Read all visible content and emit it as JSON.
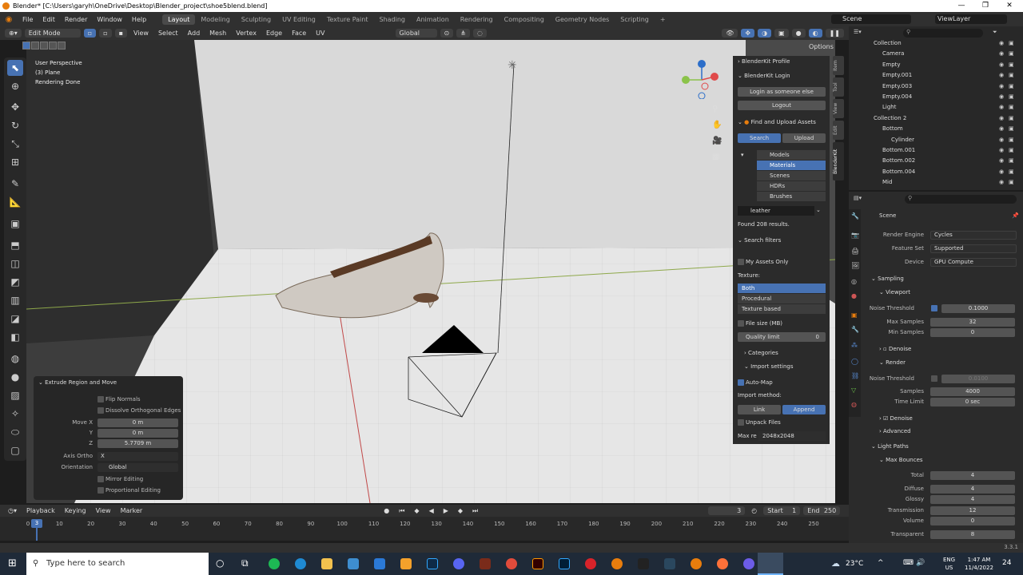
{
  "window": {
    "title": "Blender* [C:\\Users\\garyh\\OneDrive\\Desktop\\Blender_project\\shoe5blend.blend]"
  },
  "menu": [
    "File",
    "Edit",
    "Render",
    "Window",
    "Help"
  ],
  "workspaces": [
    "Layout",
    "Modeling",
    "Sculpting",
    "UV Editing",
    "Texture Paint",
    "Shading",
    "Animation",
    "Rendering",
    "Compositing",
    "Geometry Nodes",
    "Scripting"
  ],
  "scene": {
    "label": "Scene",
    "viewlayer": "ViewLayer"
  },
  "header": {
    "mode": "Edit Mode",
    "items": [
      "View",
      "Select",
      "Add",
      "Mesh",
      "Vertex",
      "Edge",
      "Face",
      "UV"
    ],
    "orientation": "Global",
    "options": "Options"
  },
  "viewport_info": {
    "line1": "User Perspective",
    "line2": "(3) Plane",
    "line3": "Rendering Done"
  },
  "redo_panel": {
    "title": "Extrude Region and Move",
    "flip_normals": "Flip Normals",
    "dissolve": "Dissolve Orthogonal Edges",
    "move_x_label": "Move X",
    "move_x": "0 m",
    "y_label": "Y",
    "y": "0 m",
    "z_label": "Z",
    "z": "5.7709 m",
    "axis_ortho_label": "Axis Ortho",
    "axis_ortho": "X",
    "orientation_label": "Orientation",
    "orientation": "Global",
    "mirror": "Mirror Editing",
    "proportional": "Proportional Editing"
  },
  "npanel": {
    "profile": "BlenderKit Profile",
    "login": "BlenderKit Login",
    "login_other": "Login as someone else",
    "logout": "Logout",
    "find": "Find and Upload Assets",
    "search": "Search",
    "upload": "Upload",
    "categories": [
      "Models",
      "Materials",
      "Scenes",
      "HDRs",
      "Brushes"
    ],
    "query": "leather",
    "found": "Found 208 results.",
    "search_filters": "Search filters",
    "my_assets": "My Assets Only",
    "texture_label": "Texture:",
    "texture_opts": [
      "Both",
      "Procedural",
      "Texture based"
    ],
    "file_size": "File size (MB)",
    "quality_label": "Quality limit",
    "quality_val": "0",
    "categories_label": "Categories",
    "import_settings": "Import settings",
    "automap": "Auto-Map",
    "import_method": "Import method:",
    "link": "Link",
    "append": "Append",
    "unpack": "Unpack Files",
    "maxres_label": "Max re",
    "maxres": "2048x2048"
  },
  "side_tabs": [
    "Item",
    "Tool",
    "View",
    "Edit",
    "BlenderKit"
  ],
  "outliner": [
    {
      "name": "Collection",
      "indent": 1
    },
    {
      "name": "Camera",
      "indent": 2
    },
    {
      "name": "Empty",
      "indent": 2
    },
    {
      "name": "Empty.001",
      "indent": 2
    },
    {
      "name": "Empty.003",
      "indent": 2
    },
    {
      "name": "Empty.004",
      "indent": 2
    },
    {
      "name": "Light",
      "indent": 2
    },
    {
      "name": "Collection 2",
      "indent": 1
    },
    {
      "name": "Bottom",
      "indent": 2
    },
    {
      "name": "Cylinder",
      "indent": 3
    },
    {
      "name": "Bottom.001",
      "indent": 2
    },
    {
      "name": "Bottom.002",
      "indent": 2
    },
    {
      "name": "Bottom.004",
      "indent": 2
    },
    {
      "name": "Mid",
      "indent": 2
    }
  ],
  "properties": {
    "scene": "Scene",
    "render_engine_label": "Render Engine",
    "render_engine": "Cycles",
    "feature_set_label": "Feature Set",
    "feature_set": "Supported",
    "device_label": "Device",
    "device": "GPU Compute",
    "sampling": "Sampling",
    "viewport": "Viewport",
    "noise_threshold": "Noise Threshold",
    "vp_noise": "0.1000",
    "max_samples_label": "Max Samples",
    "max_samples": "32",
    "min_samples_label": "Min Samples",
    "min_samples": "0",
    "denoise": "Denoise",
    "render": "Render",
    "r_noise": "0.0100",
    "samples_label": "Samples",
    "samples": "4000",
    "time_limit_label": "Time Limit",
    "time_limit": "0 sec",
    "advanced": "Advanced",
    "light_paths": "Light Paths",
    "max_bounces": "Max Bounces",
    "total_label": "Total",
    "total": "4",
    "diffuse_label": "Diffuse",
    "diffuse": "4",
    "glossy_label": "Glossy",
    "glossy": "4",
    "transmission_label": "Transmission",
    "transmission": "12",
    "volume_label": "Volume",
    "volume": "0",
    "transparent_label": "Transparent",
    "transparent": "8"
  },
  "timeline": {
    "items": [
      "Playback",
      "Keying",
      "View",
      "Marker"
    ],
    "current": "3",
    "start_label": "Start",
    "start": "1",
    "end_label": "End",
    "end": "250",
    "frames": [
      "0",
      "10",
      "20",
      "30",
      "40",
      "50",
      "60",
      "70",
      "80",
      "90",
      "100",
      "110",
      "120",
      "130",
      "140",
      "150",
      "160",
      "170",
      "180",
      "190",
      "200",
      "210",
      "220",
      "230",
      "240",
      "250"
    ],
    "playhead": "3"
  },
  "statusbar": {
    "version": "3.3.1"
  },
  "taskbar": {
    "search_placeholder": "Type here to search",
    "weather": "23°C",
    "lang1": "ENG",
    "lang2": "US",
    "time": "1:47 AM",
    "date": "11/4/2022",
    "notif": "24"
  }
}
